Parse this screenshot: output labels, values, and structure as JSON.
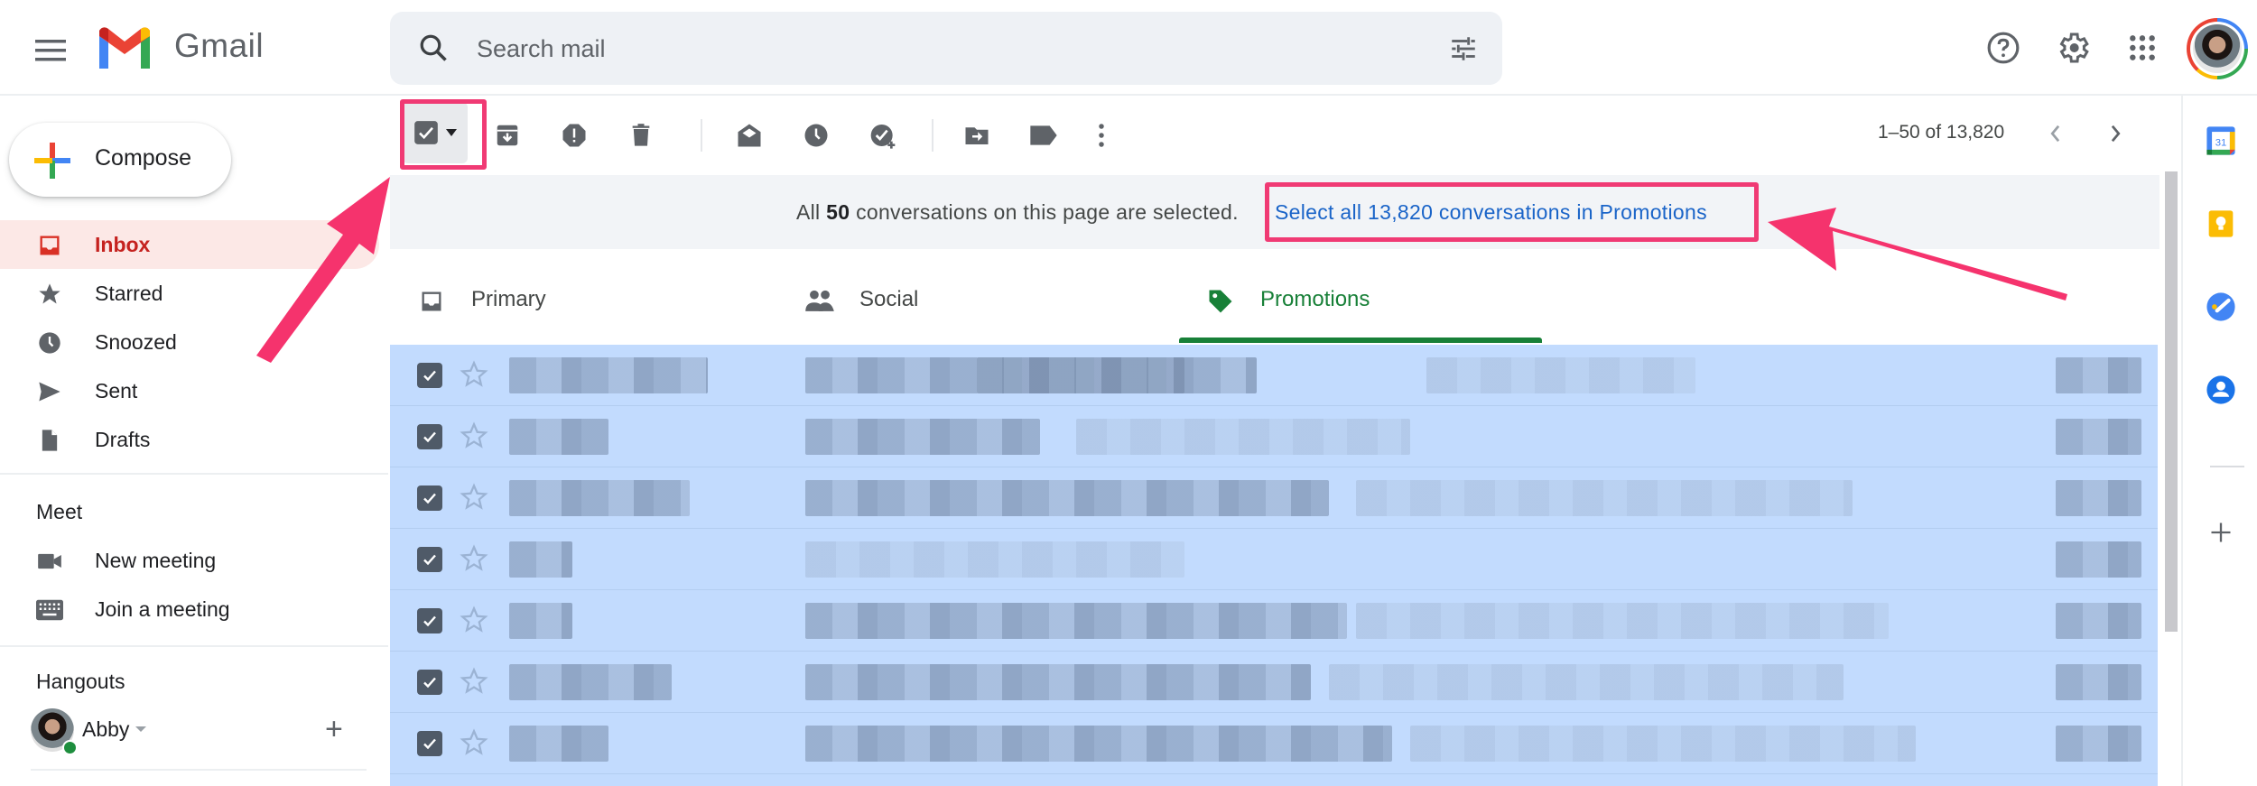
{
  "header": {
    "app_name": "Gmail",
    "menu_icon": "hamburger-menu-icon",
    "search_placeholder": "Search mail",
    "search_value": "",
    "icons": [
      "help-icon",
      "settings-icon",
      "apps-grid-icon",
      "account-avatar"
    ]
  },
  "sidebar": {
    "compose_label": "Compose",
    "items": [
      {
        "label": "Inbox",
        "icon": "inbox-icon",
        "active": true
      },
      {
        "label": "Starred",
        "icon": "star-icon",
        "active": false
      },
      {
        "label": "Snoozed",
        "icon": "clock-icon",
        "active": false
      },
      {
        "label": "Sent",
        "icon": "send-icon",
        "active": false
      },
      {
        "label": "Drafts",
        "icon": "draft-icon",
        "active": false
      }
    ],
    "meet": {
      "title": "Meet",
      "items": [
        {
          "label": "New meeting",
          "icon": "video-camera-icon"
        },
        {
          "label": "Join a meeting",
          "icon": "keyboard-icon"
        }
      ]
    },
    "hangouts": {
      "title": "Hangouts",
      "user_name": "Abby",
      "status": "online"
    }
  },
  "toolbar": {
    "select_all_checked": true,
    "actions": [
      "archive",
      "report-spam",
      "delete",
      "mark-as-read",
      "snooze",
      "add-to-tasks",
      "move-to",
      "labels",
      "more"
    ],
    "pagination": "1–50 of 13,820"
  },
  "banner": {
    "prefix": "All",
    "count": "50",
    "suffix": "conversations on this page are selected.",
    "select_all_link": "Select all 13,820 conversations in Promotions"
  },
  "tabs": [
    {
      "label": "Primary",
      "icon": "inbox-tab-icon",
      "active": false
    },
    {
      "label": "Social",
      "icon": "people-icon",
      "active": false
    },
    {
      "label": "Promotions",
      "icon": "tag-icon",
      "active": true
    }
  ],
  "mail_rows": {
    "visible_count": 7,
    "all_selected": true,
    "content": "blurred"
  },
  "side_panel": {
    "apps": [
      "Calendar",
      "Keep",
      "Tasks",
      "Contacts"
    ],
    "calendar_day": "31"
  },
  "colors": {
    "accent_red": "#c5221f",
    "promotions_green": "#188038",
    "link_blue": "#1a64c8",
    "selected_row": "#c2dbfe",
    "annotation_pink": "#f03a74"
  }
}
